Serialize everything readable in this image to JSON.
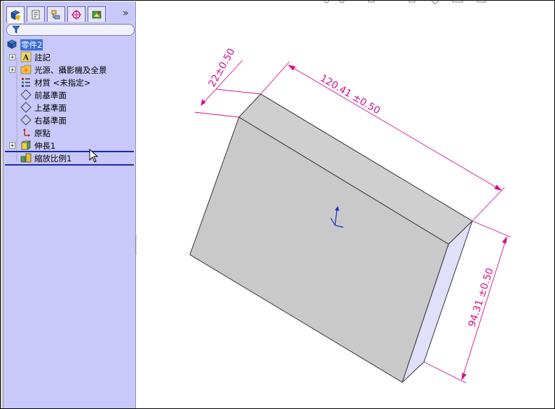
{
  "tabs": [
    {
      "name": "feature-manager",
      "icon": "feature-manager-icon"
    },
    {
      "name": "property-manager",
      "icon": "property-manager-icon"
    },
    {
      "name": "configuration-manager",
      "icon": "configuration-manager-icon"
    },
    {
      "name": "dimxpert-manager",
      "icon": "dimxpert-icon"
    },
    {
      "name": "display-manager",
      "icon": "display-manager-icon"
    }
  ],
  "more_glyph": "»",
  "tree": {
    "root": "零件2",
    "items": [
      {
        "label": "註記",
        "expand": true,
        "icon": "annotations-icon"
      },
      {
        "label": "光源、攝影機及全景",
        "expand": true,
        "icon": "lights-cameras-icon"
      },
      {
        "label": "材質 <未指定>",
        "expand": false,
        "icon": "material-icon"
      },
      {
        "label": "前基準面",
        "expand": false,
        "icon": "plane-icon"
      },
      {
        "label": "上基準面",
        "expand": false,
        "icon": "plane-icon"
      },
      {
        "label": "右基準面",
        "expand": false,
        "icon": "plane-icon"
      },
      {
        "label": "原點",
        "expand": false,
        "icon": "origin-icon"
      },
      {
        "label": "伸長1",
        "expand": true,
        "icon": "extrude-icon"
      },
      {
        "label": "縮放比例1",
        "expand": false,
        "icon": "scale-icon"
      }
    ]
  },
  "dimensions": {
    "top": "22±0.50",
    "length": "120.41 ±0.50",
    "right": "94.31 ±0.50"
  },
  "colors": {
    "panel": "#c8c8fa",
    "dimension": "#d4108c",
    "face": "#cfcfcf",
    "side_face": "#e0e0fa",
    "selection": "#1a2aa8"
  }
}
